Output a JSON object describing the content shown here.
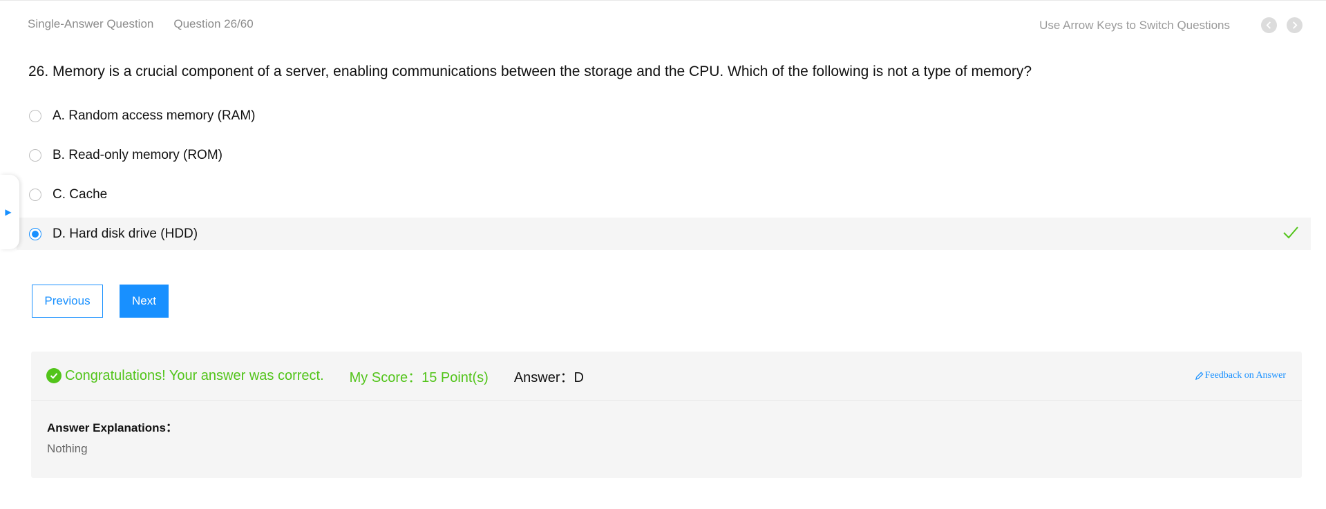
{
  "header": {
    "question_type": "Single-Answer Question",
    "progress": "Question 26/60",
    "hint": "Use Arrow Keys to Switch Questions",
    "prev_icon": "chevron-left-icon",
    "next_icon": "chevron-right-icon"
  },
  "question": {
    "text": "26. Memory is a crucial component of a server, enabling communications between the storage and the CPU. Which of the following is not a type of memory?",
    "options": [
      {
        "label": "A. Random access memory (RAM)",
        "selected": false
      },
      {
        "label": "B. Read-only memory (ROM)",
        "selected": false
      },
      {
        "label": "C. Cache",
        "selected": false
      },
      {
        "label": "D. Hard disk drive (HDD)",
        "selected": true,
        "correct": true
      }
    ]
  },
  "side_tab": {
    "icon": "play-triangle-icon",
    "glyph": "▶"
  },
  "buttons": {
    "previous": "Previous",
    "next": "Next"
  },
  "result": {
    "message": "Congratulations! Your answer was correct.",
    "score": "My Score：15 Point(s)",
    "answer": "Answer：D",
    "feedback_link": "Feedback on Answer",
    "explanation_title": "Answer Explanations：",
    "explanation_body": "Nothing"
  },
  "colors": {
    "primary": "#1890ff",
    "success": "#52c41a",
    "muted_text": "#8c8c8c",
    "panel_bg": "#f5f5f5"
  }
}
